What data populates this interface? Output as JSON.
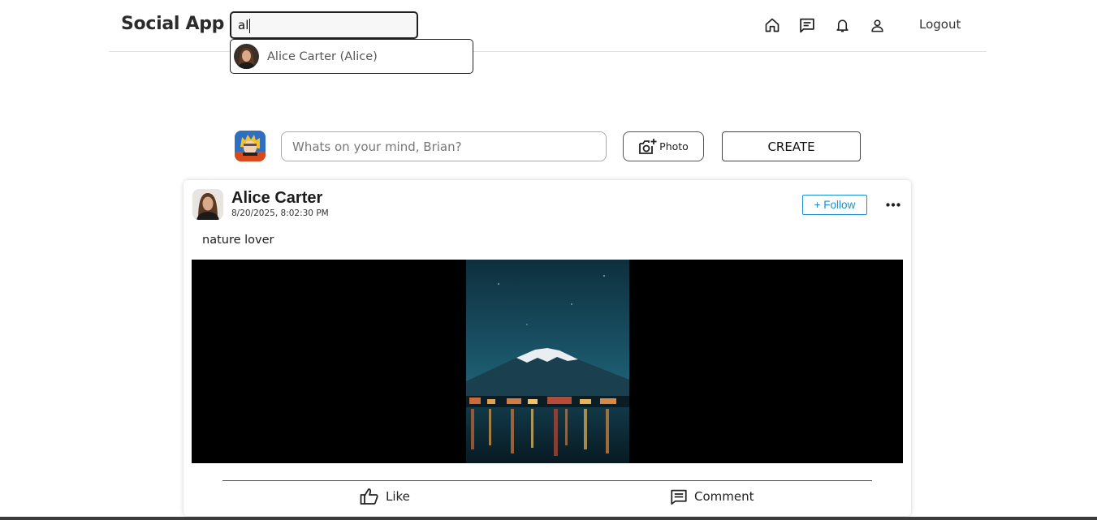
{
  "header": {
    "brand": "Social App",
    "search_value": "al",
    "logout_label": "Logout",
    "nav_icons": [
      "home-icon",
      "messages-icon",
      "bell-icon",
      "profile-icon"
    ]
  },
  "search_suggestions": [
    {
      "label": "Alice Carter (Alice)"
    }
  ],
  "composer": {
    "placeholder": "Whats on your mind, Brian?",
    "photo_label": "Photo",
    "create_label": "CREATE"
  },
  "post": {
    "author": "Alice Carter",
    "timestamp": "8/20/2025, 8:02:30 PM",
    "follow_label": "+ Follow",
    "text": "nature lover",
    "like_label": "Like",
    "comment_label": "Comment"
  },
  "colors": {
    "accent_blue": "#1a8fd6",
    "media_background": "#000000",
    "text_dark": "#222222"
  }
}
